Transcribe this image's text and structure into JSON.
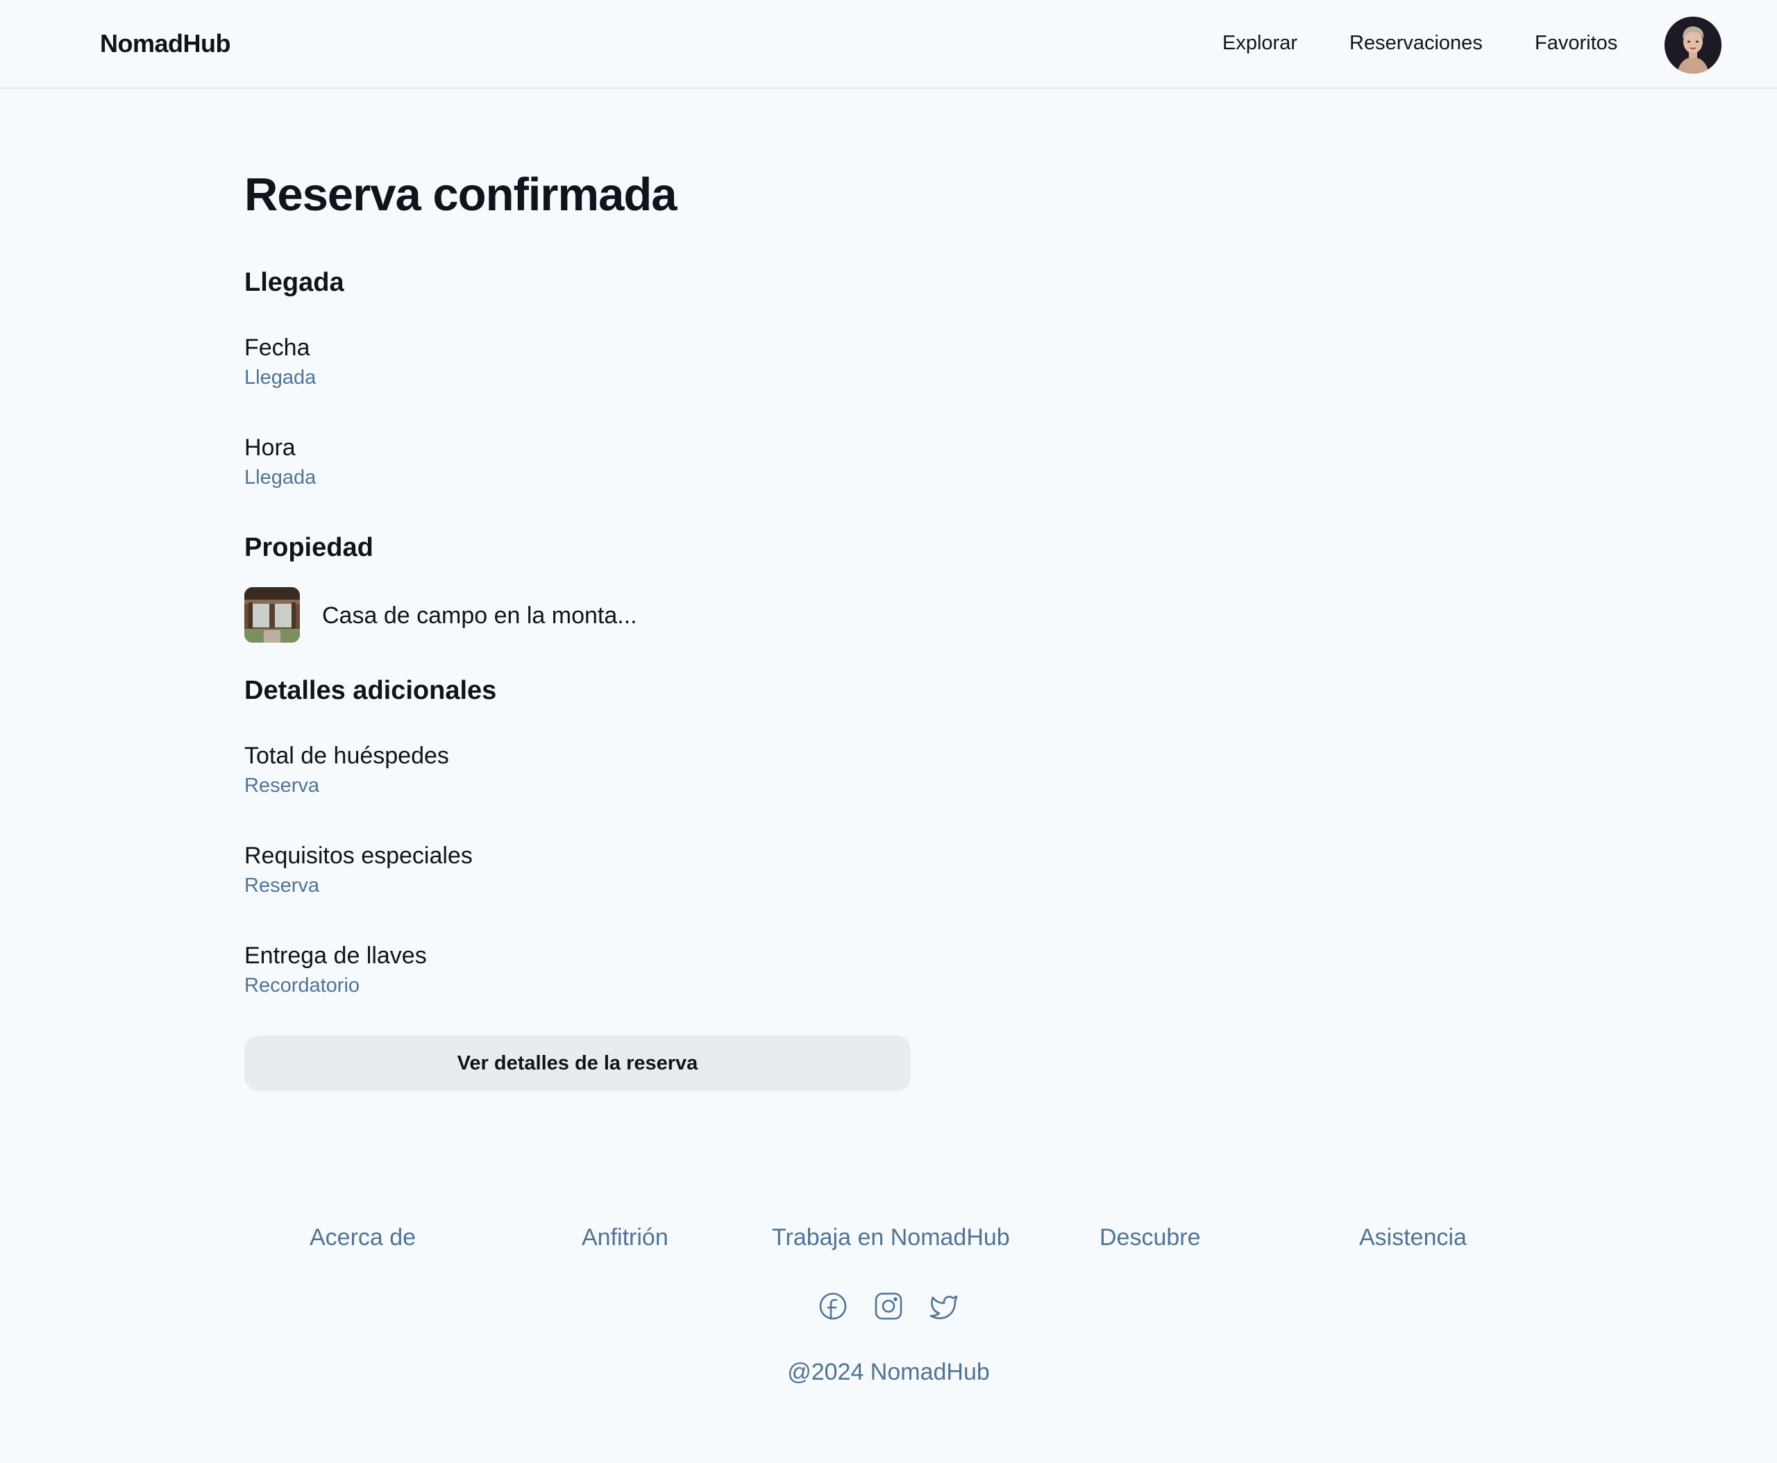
{
  "header": {
    "brand": "NomadHub",
    "nav": [
      "Explorar",
      "Reservaciones",
      "Favoritos"
    ]
  },
  "main": {
    "title": "Reserva confirmada",
    "arrival": {
      "heading": "Llegada",
      "items": [
        {
          "label": "Fecha",
          "value": "Llegada"
        },
        {
          "label": "Hora",
          "value": "Llegada"
        }
      ]
    },
    "property": {
      "heading": "Propiedad",
      "name": "Casa de campo en la monta..."
    },
    "additional": {
      "heading": "Detalles adicionales",
      "items": [
        {
          "label": "Total de huéspedes",
          "value": "Reserva"
        },
        {
          "label": "Requisitos especiales",
          "value": "Reserva"
        },
        {
          "label": "Entrega de llaves",
          "value": "Recordatorio"
        }
      ]
    },
    "button_label": "Ver detalles de la reserva"
  },
  "footer": {
    "links": [
      "Acerca de",
      "Anfitrión",
      "Trabaja en NomadHub",
      "Descubre",
      "Asistencia"
    ],
    "social_icons": [
      "facebook-icon",
      "instagram-icon",
      "twitter-icon"
    ],
    "copyright": "@2024 NomadHub"
  },
  "colors": {
    "background": "#f7fafc",
    "text": "#0d141c",
    "muted": "#4f7396",
    "button_bg": "#e8ecef",
    "divider": "#e5e8eb"
  }
}
